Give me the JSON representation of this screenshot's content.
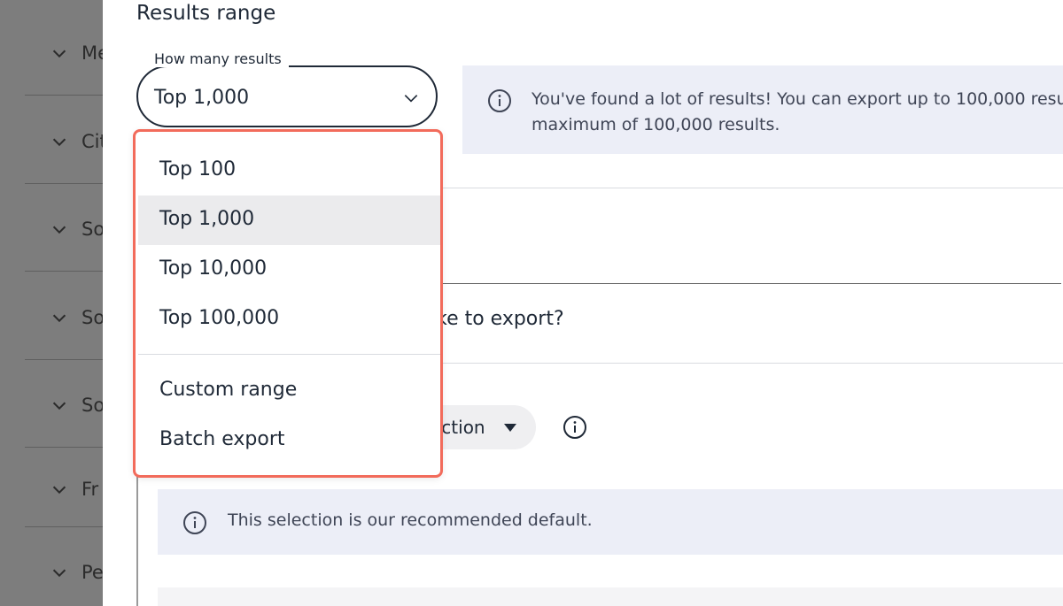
{
  "sidebar": {
    "items": [
      {
        "label": "Me"
      },
      {
        "label": "Cit"
      },
      {
        "label": "So"
      },
      {
        "label": "So"
      },
      {
        "label": "So"
      },
      {
        "label": "Fr"
      },
      {
        "label": "Pe"
      }
    ]
  },
  "results": {
    "title": "Results range",
    "select": {
      "legend": "How many results",
      "value": "Top 1,000"
    },
    "banner": {
      "line1": "You've found a lot of results! You can export up to 100,000 resu",
      "line2": "maximum of 100,000 results."
    },
    "menu": {
      "items": [
        "Top 100",
        "Top 1,000",
        "Top 10,000",
        "Top 100,000"
      ],
      "selected": "Top 1,000",
      "extra_items": [
        "Custom range",
        "Batch export"
      ]
    }
  },
  "export": {
    "question": "ike to export?",
    "selection_label": "ection",
    "default_note": "This selection is our recommended default."
  },
  "colors": {
    "menu_border": "#f26b5b",
    "banner_bg": "#eceef7",
    "sidebar_overlay": "#7d7d7d"
  },
  "icons": [
    "chevron-down-icon",
    "info-icon",
    "caret-down-icon"
  ]
}
